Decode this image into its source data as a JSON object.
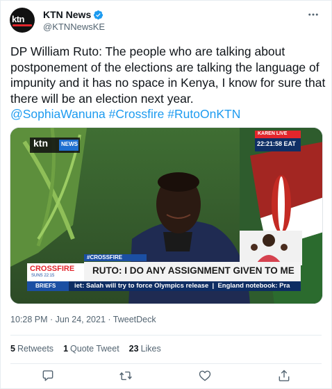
{
  "tweet": {
    "author": {
      "display_name": "KTN News",
      "handle": "@KTNNewsKE",
      "avatar_logo": "ktn",
      "verified": true
    },
    "text_main": "DP William Ruto: The people who are talking about postponement of the elections are talking the language of impunity and it has no space in Kenya, I know for sure that there will be an election next year.",
    "mentions": [
      "@SophiaWanuna",
      "#Crossfire",
      "#RutoOnKTN"
    ],
    "media": {
      "channel_logo": "ktn",
      "channel_sub": "NEWS",
      "location_tag": "KAREN LIVE",
      "clock": "22:21:58 EAT",
      "show_tag": "#CROSSFIRE",
      "show_name": "CROSSFIRE",
      "show_time": "SUNS 22:15",
      "headline": "RUTO: I DO ANY ASSIGNMENT GIVEN TO ME",
      "ticker_label": "BRIEFS",
      "ticker_text": "iet: Salah will try to force Olympics release  |  England notebook: Pra"
    },
    "timestamp": "10:28 PM · Jun 24, 2021 · TweetDeck"
  },
  "stats": {
    "retweets_count": "5",
    "retweets_label": "Retweets",
    "quotes_count": "1",
    "quotes_label": "Quote Tweet",
    "likes_count": "23",
    "likes_label": "Likes"
  },
  "icons": {
    "more": "more-icon",
    "reply": "reply-icon",
    "retweet": "retweet-icon",
    "like": "like-icon",
    "share": "share-icon"
  },
  "colors": {
    "link": "#1d9bf0",
    "muted": "#536471",
    "text": "#0f1419",
    "verified": "#1d9bf0",
    "ktn_red": "#e3262c"
  }
}
